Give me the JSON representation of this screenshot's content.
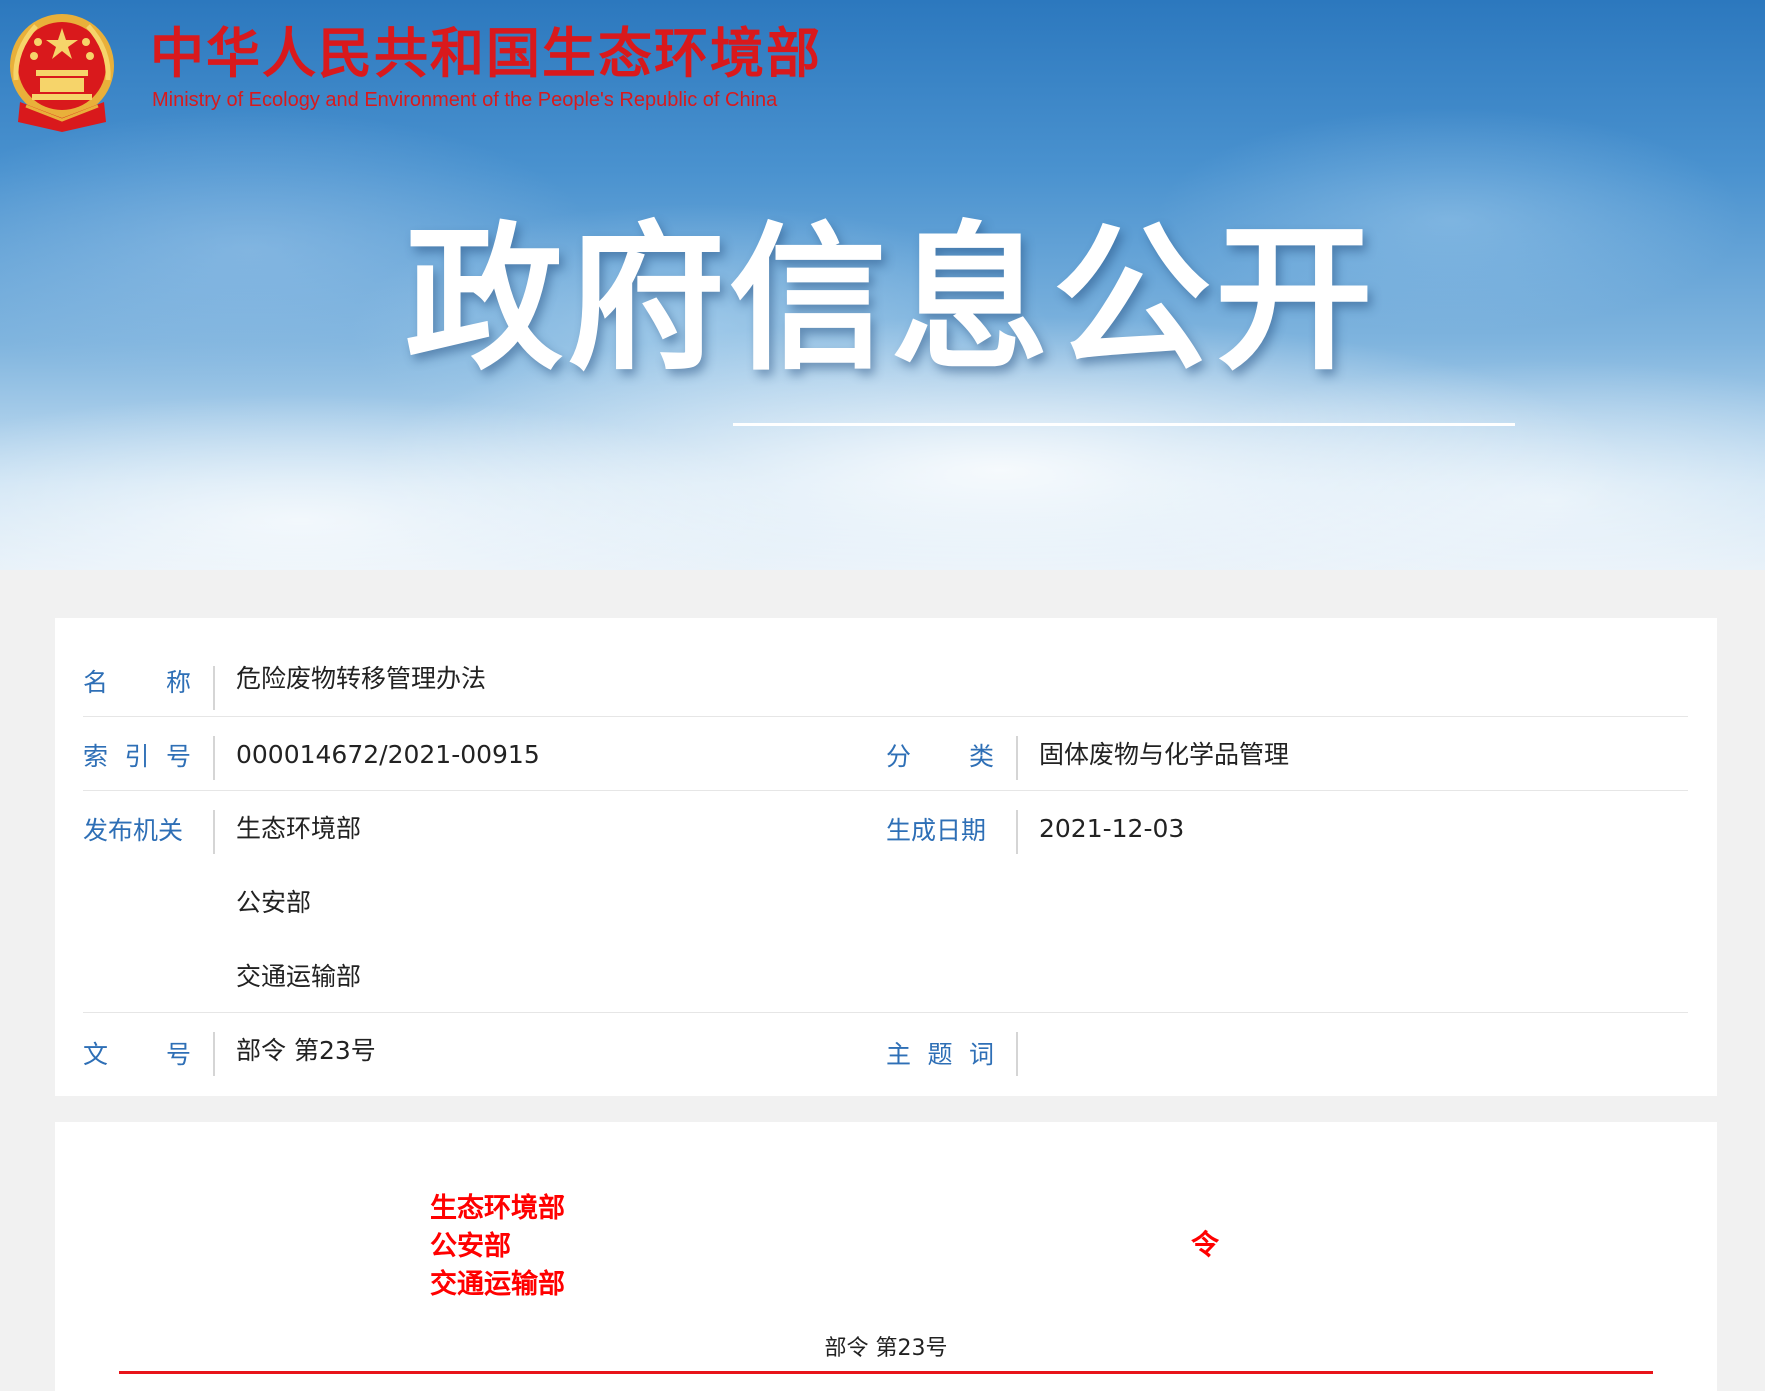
{
  "header": {
    "ministry_name_cn": "中华人民共和国生态环境部",
    "ministry_name_en": "Ministry of Ecology and Environment of the People's Republic of China",
    "banner_title": "政府信息公开",
    "emblem_icon": "national-emblem-icon"
  },
  "info": {
    "name_label": [
      "名",
      "称"
    ],
    "name_value": "危险废物转移管理办法",
    "index_label": [
      "索",
      "引",
      "号"
    ],
    "index_value": "000014672/2021-00915",
    "category_label": [
      "分",
      "类"
    ],
    "category_value": "固体废物与化学品管理",
    "publisher_label": [
      "发布机关"
    ],
    "publisher_values": [
      "生态环境部",
      "公安部",
      "交通运输部"
    ],
    "date_label": [
      "生成日期"
    ],
    "date_value": "2021-12-03",
    "doc_no_label": [
      "文",
      "号"
    ],
    "doc_no_value": "部令 第23号",
    "keywords_label": [
      "主",
      "题",
      "词"
    ],
    "keywords_value": ""
  },
  "document": {
    "issuers": [
      "生态环境部",
      "公安部",
      "交通运输部"
    ],
    "order_char": "令",
    "doc_number": "部令 第23号"
  },
  "colors": {
    "label_blue": "#2e6fb6",
    "issuer_red": "#ff0000",
    "ministry_red": "#d9191c"
  }
}
